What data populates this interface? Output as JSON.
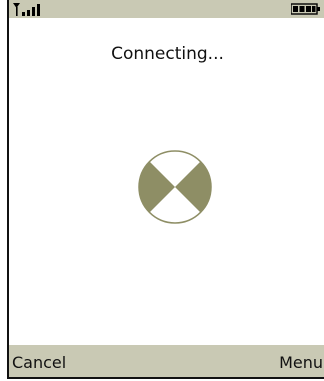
{
  "status_bar": {
    "signal_icon": "signal-strength-icon",
    "battery_icon": "battery-icon"
  },
  "screen": {
    "title": "Connecting..."
  },
  "spinner": {
    "icon": "loading-spinner-icon",
    "colors": {
      "fill": "#8e8e65",
      "outline": "#8e8e65",
      "background": "#ffffff"
    }
  },
  "softkeys": {
    "left_label": "Cancel",
    "right_label": "Menu"
  },
  "colors": {
    "bar_background": "#c9c9b4",
    "text": "#111111"
  }
}
